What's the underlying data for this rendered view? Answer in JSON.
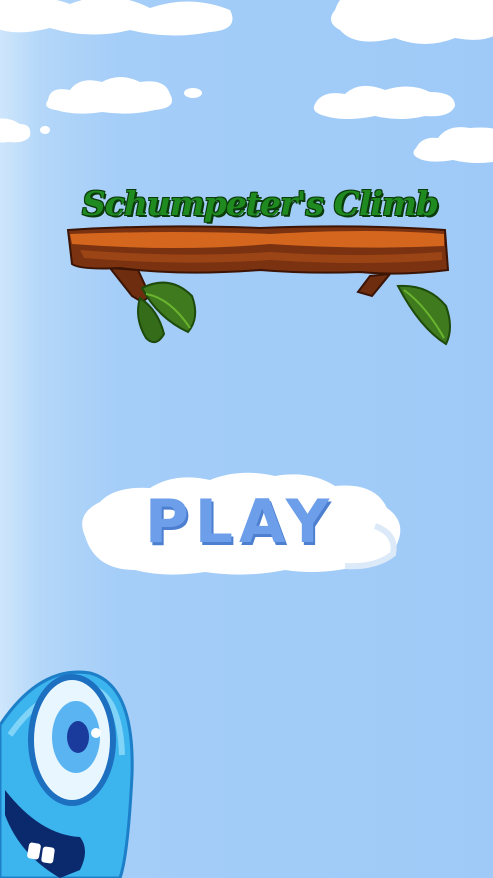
{
  "game": {
    "title": "Schumpeter's Climb",
    "play_label": "PLAY"
  },
  "colors": {
    "sky": "#a0cbf7",
    "title_green": "#1f8a1f",
    "branch_brown": "#8b3a14",
    "play_text": "#6d9eea",
    "mascot_blue": "#3cb4ee"
  },
  "icons": {
    "logo": "wooden-branch-logo",
    "mascot": "blue-one-eyed-creature"
  }
}
